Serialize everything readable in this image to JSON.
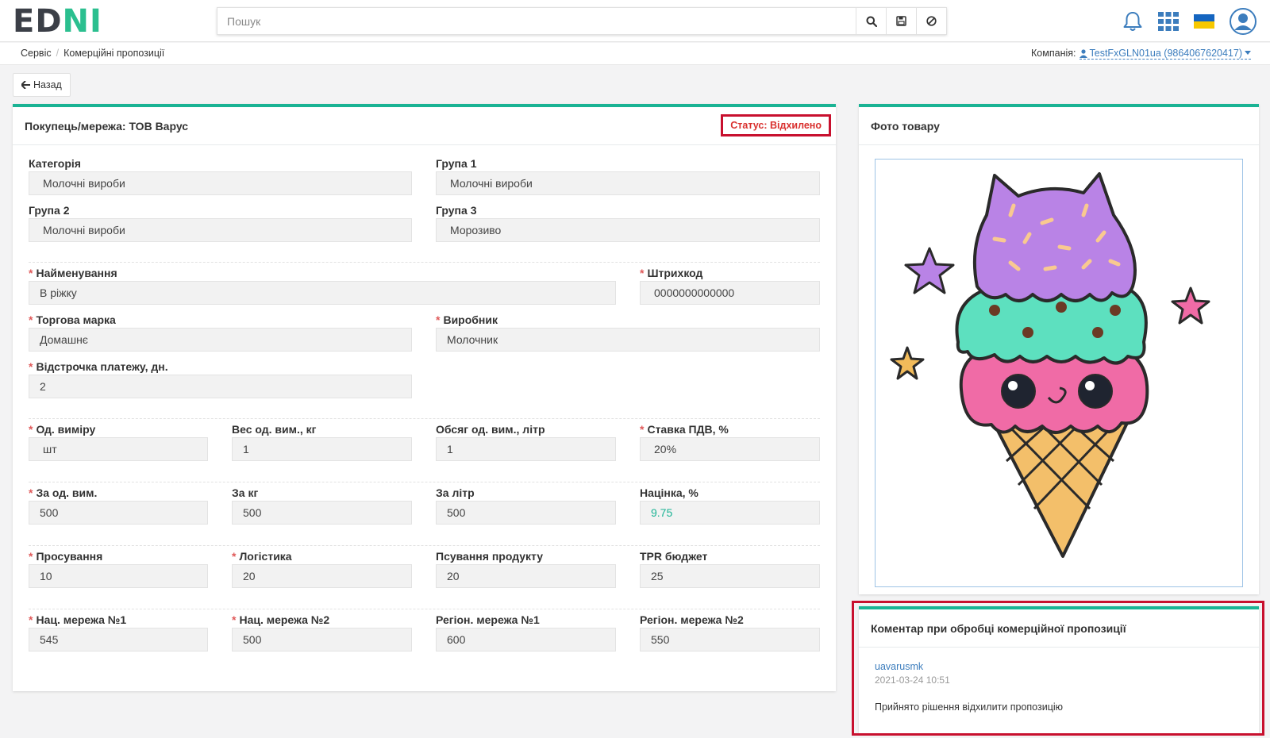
{
  "app": {
    "logo_left": "ED",
    "logo_right": "NI"
  },
  "search": {
    "placeholder": "Пошук"
  },
  "topbar": {
    "icons": [
      "search-icon",
      "save-icon",
      "ban-icon",
      "bell-icon",
      "apps-grid-icon",
      "ukraine-flag-icon",
      "user-avatar-icon"
    ]
  },
  "breadcrumb": {
    "items": [
      "Сервіс",
      "Комерційні пропозиції"
    ]
  },
  "company": {
    "label": "Компанія:",
    "value": "TestFxGLN01ua (9864067620417)"
  },
  "back_button": {
    "label": "Назад"
  },
  "proposal": {
    "title": "Покупець/мережа: ТОВ Варус",
    "status": "Статус: Відхилено",
    "colors": {
      "accent": "#1ab394",
      "status_red": "#c8102e"
    },
    "fields": {
      "category": {
        "label": "Категорія",
        "value": "Молочні вироби"
      },
      "group1": {
        "label": "Група 1",
        "value": "Молочні вироби"
      },
      "group2": {
        "label": "Група 2",
        "value": "Молочні вироби"
      },
      "group3": {
        "label": "Група 3",
        "value": "Морозиво"
      },
      "name": {
        "label": "Найменування",
        "value": "В ріжку",
        "required": true
      },
      "barcode": {
        "label": "Штрихкод",
        "value": "0000000000000",
        "required": true
      },
      "brand": {
        "label": "Торгова марка",
        "value": "Домашнє",
        "required": true
      },
      "manufacturer": {
        "label": "Виробник",
        "value": "Молочник",
        "required": true
      },
      "payment_delay": {
        "label": "Відстрочка платежу, дн.",
        "value": "2",
        "required": true
      },
      "unit": {
        "label": "Од. виміру",
        "value": "шт",
        "required": true
      },
      "unit_weight": {
        "label": "Вес од. вим., кг",
        "value": "1"
      },
      "unit_volume": {
        "label": "Обсяг од. вим., літр",
        "value": "1"
      },
      "vat_rate": {
        "label": "Ставка ПДВ, %",
        "value": "20%",
        "required": true
      },
      "price_per_unit": {
        "label": "За од. вим.",
        "value": "500",
        "required": true
      },
      "price_per_kg": {
        "label": "За кг",
        "value": "500"
      },
      "price_per_liter": {
        "label": "За літр",
        "value": "500"
      },
      "markup": {
        "label": "Націнка, %",
        "value": "9.75"
      },
      "promotion": {
        "label": "Просування",
        "value": "10",
        "required": true
      },
      "logistics": {
        "label": "Логістика",
        "value": "20",
        "required": true
      },
      "spoilage": {
        "label": "Псування продукту",
        "value": "20"
      },
      "tpr_budget": {
        "label": "TPR бюджет",
        "value": "25"
      },
      "nat_network1": {
        "label": "Нац. мережа №1",
        "value": "545",
        "required": true
      },
      "nat_network2": {
        "label": "Нац. мережа №2",
        "value": "500",
        "required": true
      },
      "reg_network1": {
        "label": "Регіон. мережа №1",
        "value": "600"
      },
      "reg_network2": {
        "label": "Регіон. мережа №2",
        "value": "550"
      }
    }
  },
  "photo": {
    "title": "Фото товару",
    "image": "ice-cream-cone-illustration"
  },
  "comment": {
    "title": "Коментар при обробці комерційної пропозиції",
    "user": "uavarusmk",
    "date": "2021-03-24 10:51",
    "text": "Прийнято рішення відхилити пропозицію"
  }
}
